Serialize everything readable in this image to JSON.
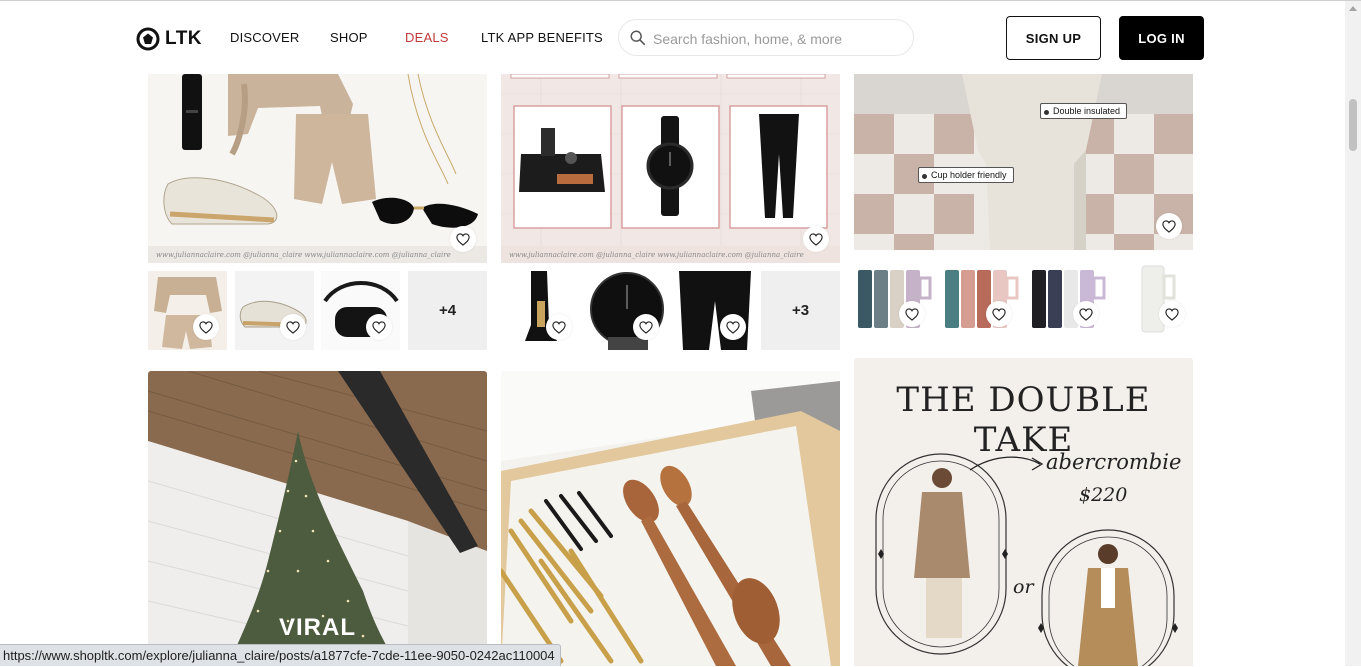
{
  "brand": {
    "name": "LTK"
  },
  "nav": {
    "discover": "DISCOVER",
    "shop": "SHOP",
    "deals": "DEALS",
    "app_benefits": "LTK APP BENEFITS"
  },
  "search": {
    "placeholder": "Search fashion, home, & more",
    "value": ""
  },
  "auth": {
    "signup": "SIGN UP",
    "login": "LOG IN"
  },
  "posts": {
    "outfit": {
      "watermark": "www.juliannaclaire.com   @julianna_claire   www.juliannaclaire.com   @julianna_claire",
      "more_count": "+4"
    },
    "mens": {
      "watermark": "www.juliannaclaire.com   @julianna_claire   www.juliannaclaire.com   @julianna_claire",
      "more_count": "+3"
    },
    "tumbler": {
      "callout_1": "Double insulated",
      "callout_2": "Cup holder friendly"
    },
    "tree": {
      "caption": "VIRAL"
    },
    "double_take": {
      "title": "THE DOUBLE TAKE",
      "brand": "abercrombie",
      "price": "$220",
      "or": "or"
    }
  },
  "status_url": "https://www.shopltk.com/explore/julianna_claire/posts/a1877cfe-7cde-11ee-9050-0242ac110004",
  "colors": {
    "accent_deals": "#c23b3b",
    "login_bg": "#000000",
    "status_bg": "#dee1e6"
  }
}
